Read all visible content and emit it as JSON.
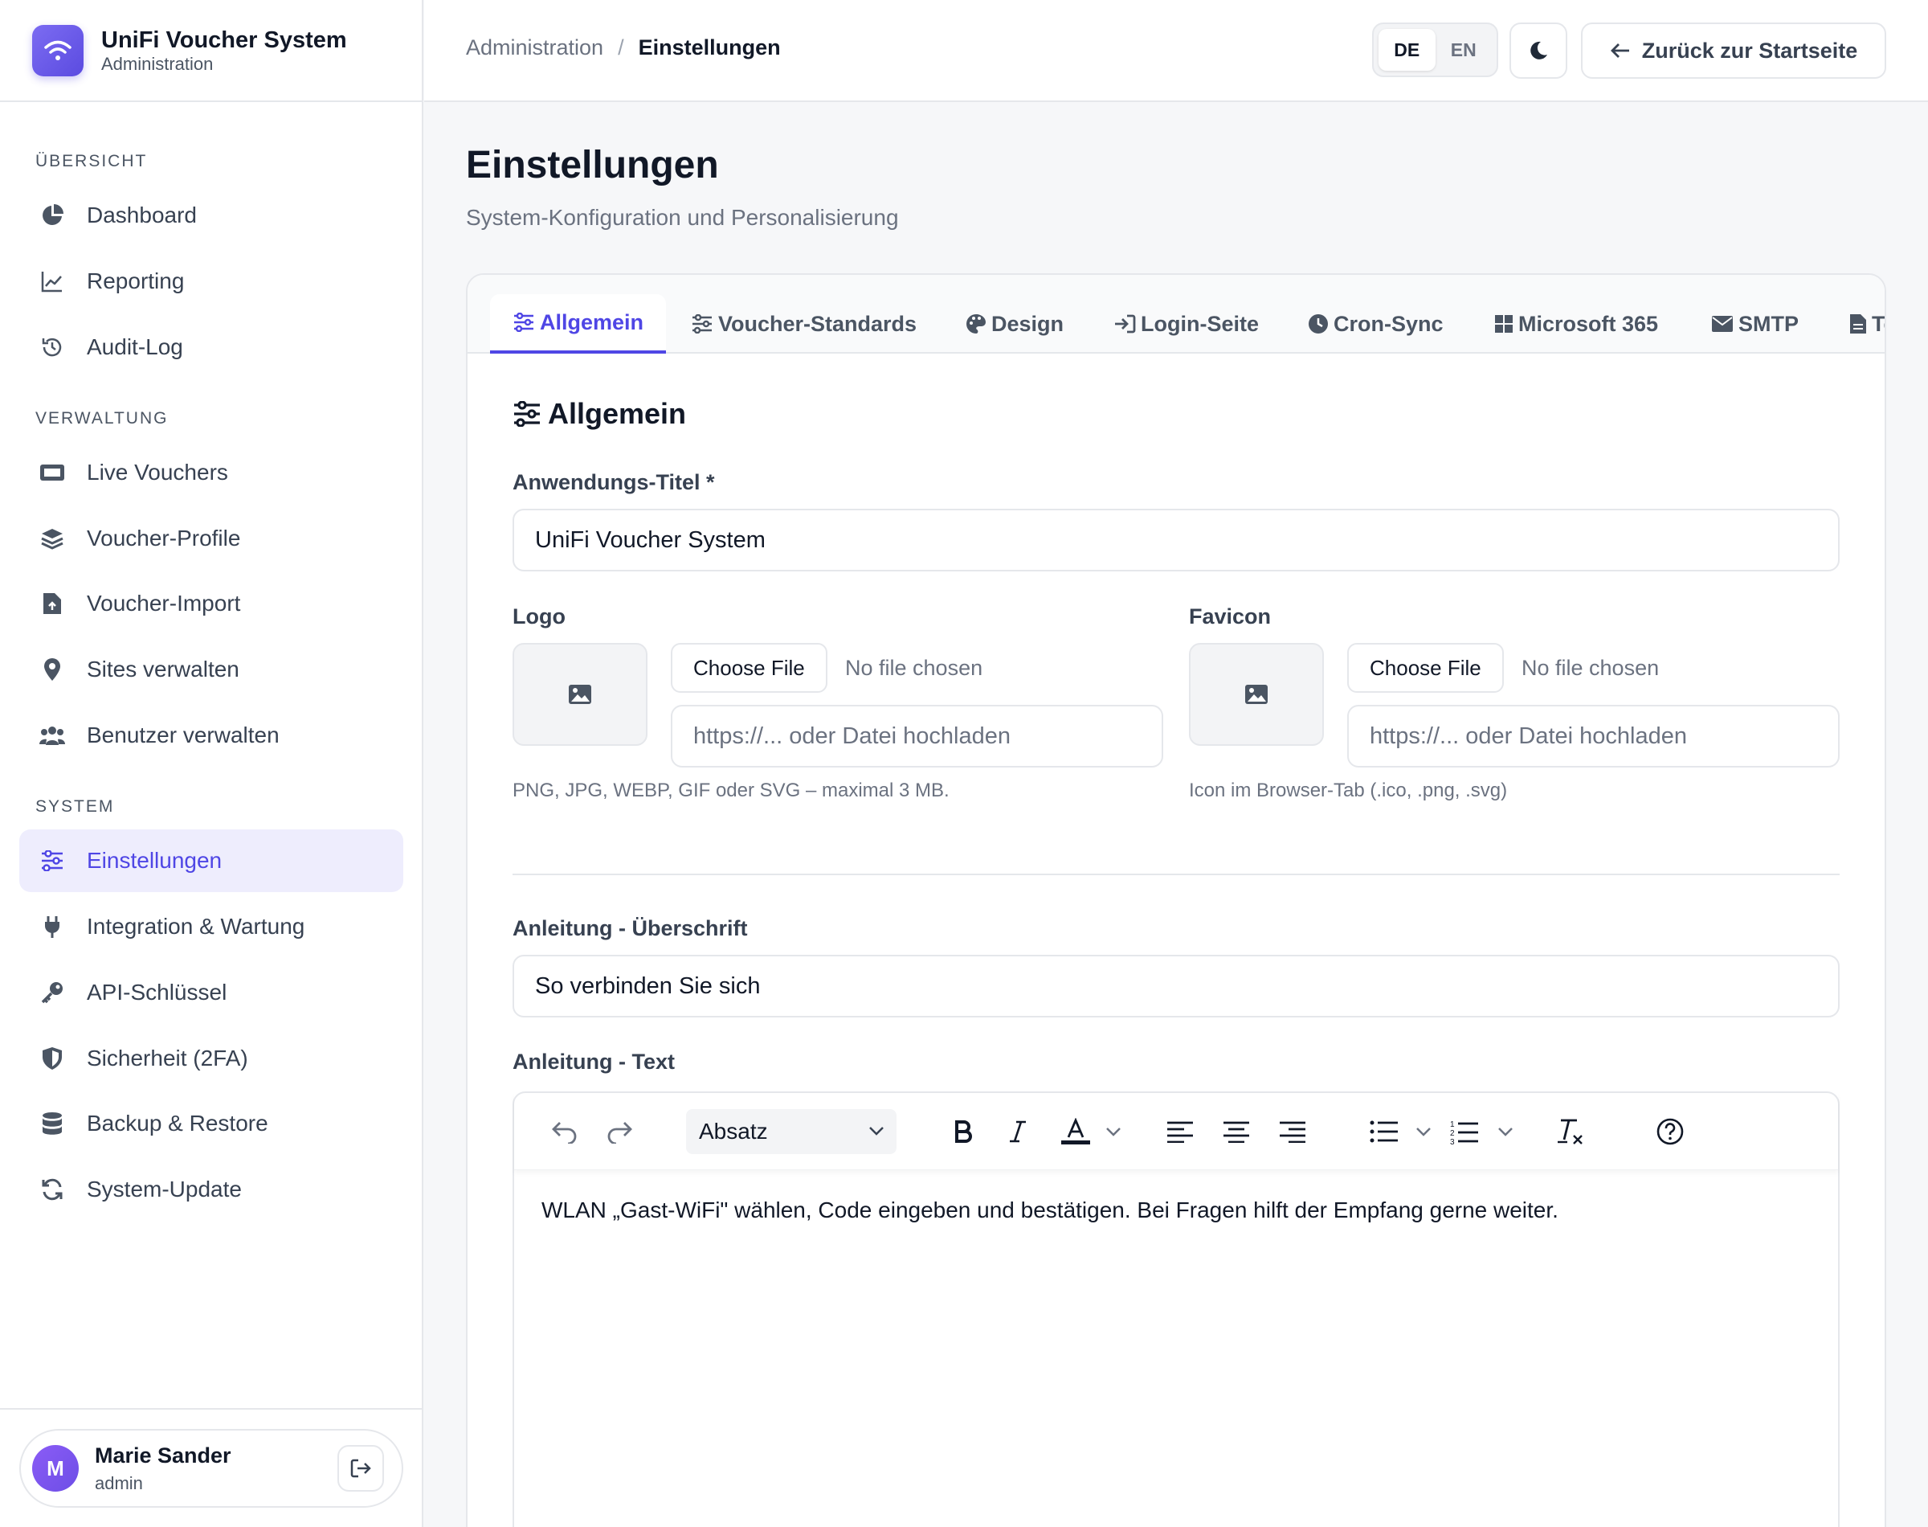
{
  "app": {
    "title": "UniFi Voucher System",
    "subtitle": "Administration",
    "brand_color": "#6d5ce8"
  },
  "sidebar": {
    "sections": [
      {
        "label": "ÜBERSICHT",
        "items": [
          {
            "label": "Dashboard",
            "icon": "pie-chart-icon"
          },
          {
            "label": "Reporting",
            "icon": "line-chart-icon"
          },
          {
            "label": "Audit-Log",
            "icon": "history-icon"
          }
        ]
      },
      {
        "label": "VERWALTUNG",
        "items": [
          {
            "label": "Live Vouchers",
            "icon": "ticket-icon"
          },
          {
            "label": "Voucher-Profile",
            "icon": "layers-icon"
          },
          {
            "label": "Voucher-Import",
            "icon": "file-upload-icon"
          },
          {
            "label": "Sites verwalten",
            "icon": "map-pin-icon"
          },
          {
            "label": "Benutzer verwalten",
            "icon": "users-icon"
          }
        ]
      },
      {
        "label": "SYSTEM",
        "items": [
          {
            "label": "Einstellungen",
            "icon": "sliders-icon",
            "active": true
          },
          {
            "label": "Integration & Wartung",
            "icon": "plug-icon"
          },
          {
            "label": "API-Schlüssel",
            "icon": "key-icon"
          },
          {
            "label": "Sicherheit (2FA)",
            "icon": "shield-icon"
          },
          {
            "label": "Backup & Restore",
            "icon": "database-icon"
          },
          {
            "label": "System-Update",
            "icon": "refresh-icon"
          }
        ]
      }
    ],
    "user": {
      "initial": "M",
      "name": "Marie Sander",
      "role": "admin"
    }
  },
  "header": {
    "breadcrumb": [
      "Administration",
      "Einstellungen"
    ],
    "separator": "/",
    "languages": [
      "DE",
      "EN"
    ],
    "active_language": "DE",
    "back_label": "Zurück zur Startseite"
  },
  "page": {
    "title": "Einstellungen",
    "subtitle": "System-Konfiguration und Personalisierung"
  },
  "tabs": [
    {
      "label": "Allgemein",
      "icon": "sliders-icon",
      "active": true
    },
    {
      "label": "Voucher-Standards",
      "icon": "sliders-icon"
    },
    {
      "label": "Design",
      "icon": "palette-icon"
    },
    {
      "label": "Login-Seite",
      "icon": "sign-in-icon"
    },
    {
      "label": "Cron-Sync",
      "icon": "clock-icon"
    },
    {
      "label": "Microsoft 365",
      "icon": "windows-icon"
    },
    {
      "label": "SMTP",
      "icon": "envelope-icon"
    },
    {
      "label": "Te",
      "icon": "file-icon"
    }
  ],
  "form": {
    "section_title": "Allgemein",
    "app_title": {
      "label": "Anwendungs-Titel *",
      "value": "UniFi Voucher System"
    },
    "logo": {
      "label": "Logo",
      "file_button": "Choose File",
      "file_status": "No file chosen",
      "placeholder": "https://... oder Datei hochladen",
      "hint": "PNG, JPG, WEBP, GIF oder SVG – maximal 3 MB."
    },
    "favicon": {
      "label": "Favicon",
      "file_button": "Choose File",
      "file_status": "No file chosen",
      "placeholder": "https://... oder Datei hochladen",
      "hint": "Icon im Browser-Tab (.ico, .png, .svg)"
    },
    "instructions_heading": {
      "label": "Anleitung - Überschrift",
      "value": "So verbinden Sie sich"
    },
    "instructions_text": {
      "label": "Anleitung - Text",
      "block_format": "Absatz",
      "content": "WLAN „Gast-WiFi\" wählen, Code eingeben und bestätigen. Bei Fragen hilft der Empfang gerne weiter."
    }
  }
}
